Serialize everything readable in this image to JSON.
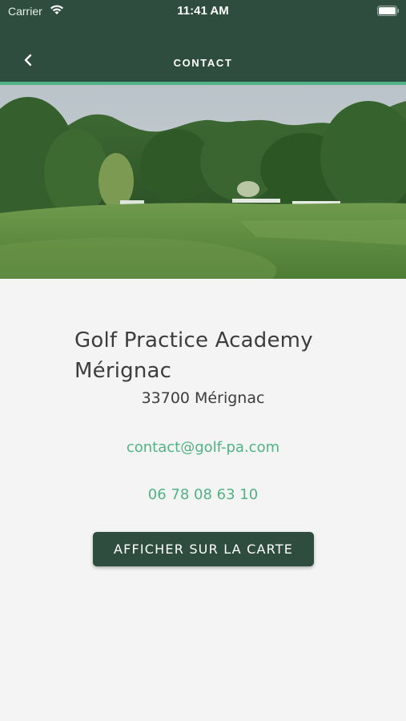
{
  "status_bar": {
    "carrier": "Carrier",
    "time": "11:41 AM",
    "wifi_icon": "wifi-icon",
    "battery_icon": "battery-icon"
  },
  "nav": {
    "title": "CONTACT",
    "back_icon": "chevron-left-icon"
  },
  "hero": {
    "image": "golf course fairway with trees"
  },
  "contact": {
    "name": "Golf Practice Academy Mérignac",
    "address": "33700 Mérignac",
    "email": "contact@golf-pa.com",
    "phone": "06 78 08 63 10",
    "map_button_label": "AFFICHER SUR LA CARTE"
  },
  "colors": {
    "header_bg": "#2e4d3f",
    "accent": "#4fb385",
    "text": "#3d3d3d",
    "background": "#f4f4f4"
  }
}
